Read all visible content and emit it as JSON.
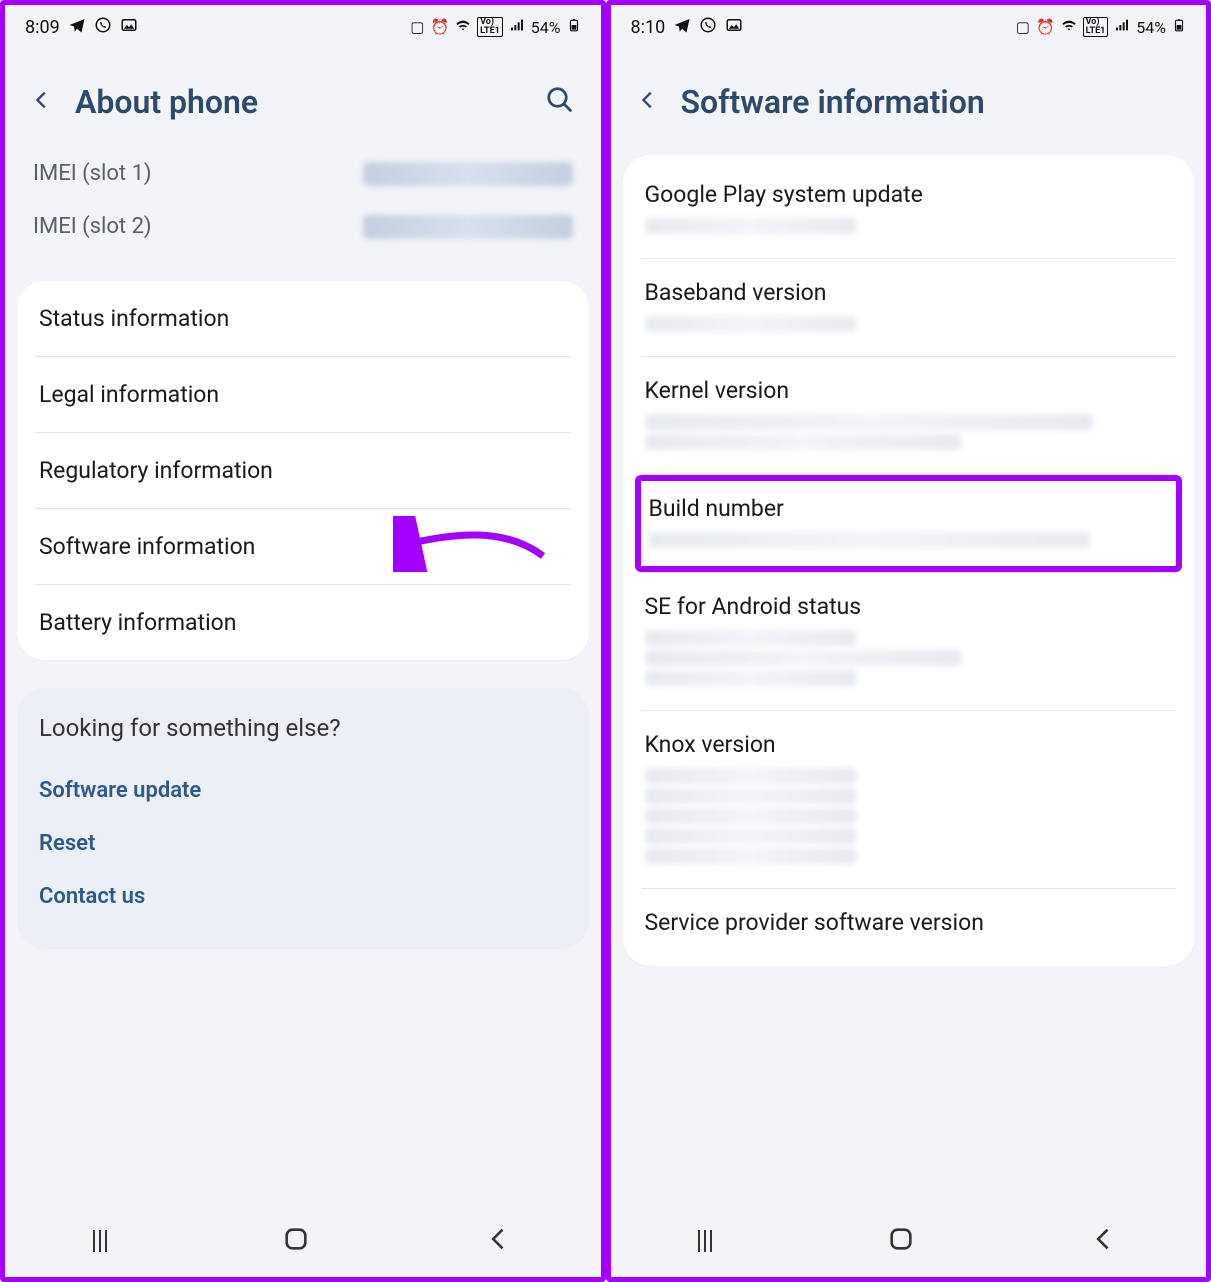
{
  "left": {
    "status": {
      "time": "8:09",
      "battery": "54%"
    },
    "header": {
      "title": "About phone"
    },
    "imei": [
      {
        "label": "IMEI (slot 1)"
      },
      {
        "label": "IMEI (slot 2)"
      }
    ],
    "menu": [
      "Status information",
      "Legal information",
      "Regulatory information",
      "Software information",
      "Battery information"
    ],
    "looking": {
      "title": "Looking for something else?",
      "links": [
        "Software update",
        "Reset",
        "Contact us"
      ]
    }
  },
  "right": {
    "status": {
      "time": "8:10",
      "battery": "54%"
    },
    "header": {
      "title": "Software information"
    },
    "items": [
      "Google Play system update",
      "Baseband version",
      "Kernel version",
      "Build number",
      "SE for Android status",
      "Knox version",
      "Service provider software version"
    ],
    "highlight_index": 3
  }
}
